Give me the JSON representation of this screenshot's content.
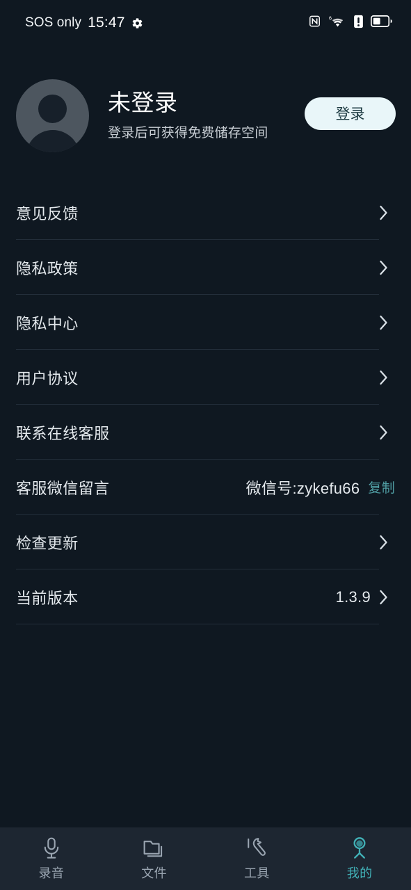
{
  "statusbar": {
    "carrier": "SOS only",
    "time": "15:47",
    "gear_icon": "gear-icon",
    "nfc_icon": "nfc-icon",
    "wifi_icon": "wifi-6-icon",
    "alert_icon": "sim-alert-icon",
    "battery_icon": "battery-icon"
  },
  "profile": {
    "avatar_icon": "default-avatar-icon",
    "name": "未登录",
    "subtitle": "登录后可获得免费储存空间",
    "login_label": "登录"
  },
  "list": {
    "rows": [
      {
        "label": "意见反馈",
        "value": "",
        "action": "",
        "chevron": true
      },
      {
        "label": "隐私政策",
        "value": "",
        "action": "",
        "chevron": true
      },
      {
        "label": "隐私中心",
        "value": "",
        "action": "",
        "chevron": true
      },
      {
        "label": "用户协议",
        "value": "",
        "action": "",
        "chevron": true
      },
      {
        "label": "联系在线客服",
        "value": "",
        "action": "",
        "chevron": true
      },
      {
        "label": "客服微信留言",
        "value": "微信号:zykefu66",
        "action": "复制",
        "chevron": false
      },
      {
        "label": "检查更新",
        "value": "",
        "action": "",
        "chevron": true
      },
      {
        "label": "当前版本",
        "value": "1.3.9",
        "action": "",
        "chevron": true
      }
    ]
  },
  "tabbar": {
    "tabs": [
      {
        "label": "录音",
        "icon": "microphone-icon",
        "active": false
      },
      {
        "label": "文件",
        "icon": "folder-icon",
        "active": false
      },
      {
        "label": "工具",
        "icon": "wrench-icon",
        "active": false
      },
      {
        "label": "我的",
        "icon": "person-icon",
        "active": true
      }
    ]
  },
  "colors": {
    "background": "#0f1821",
    "tabbar_background": "#1d2631",
    "accent": "#41b0b6",
    "copy_link": "#4f9ca2",
    "login_button_bg": "#e9f6f9",
    "divider": "#232e3a"
  }
}
